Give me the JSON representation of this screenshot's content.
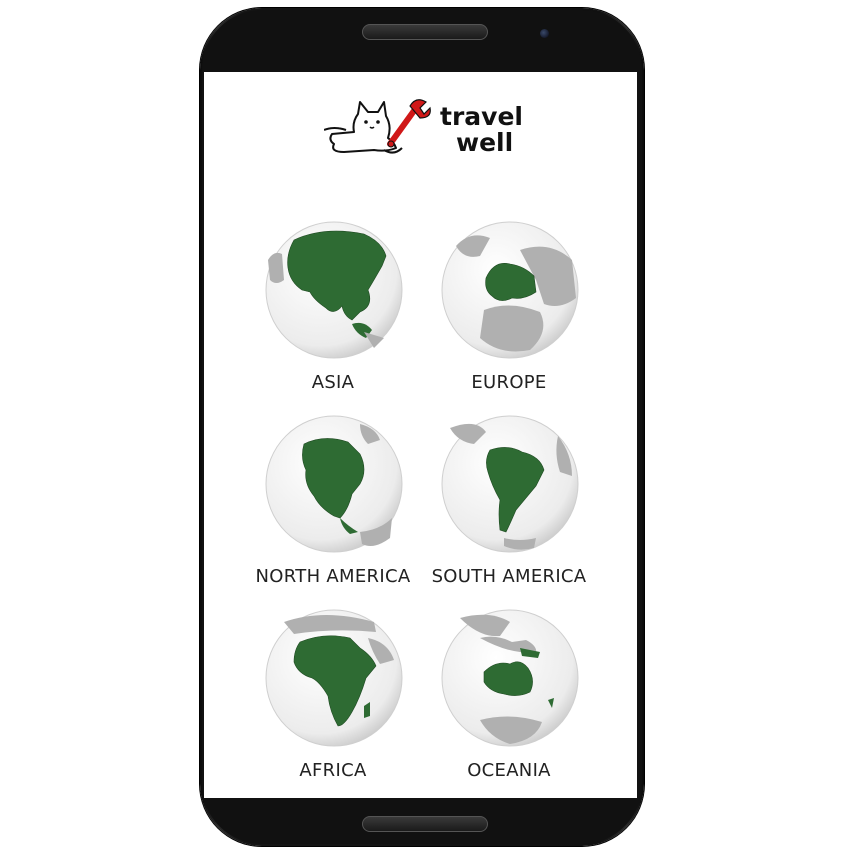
{
  "app": {
    "logo_line1": "travel",
    "logo_line2": "well"
  },
  "continents": [
    {
      "label": "ASIA",
      "icon": "asia-globe-icon"
    },
    {
      "label": "EUROPE",
      "icon": "europe-globe-icon"
    },
    {
      "label": "NORTH AMERICA",
      "icon": "north-america-globe-icon"
    },
    {
      "label": "SOUTH AMERICA",
      "icon": "south-america-globe-icon"
    },
    {
      "label": "AFRICA",
      "icon": "africa-globe-icon"
    },
    {
      "label": "OCEANIA",
      "icon": "oceania-globe-icon"
    }
  ],
  "colors": {
    "highlight": "#2e6b33",
    "land_gray": "#b0b0b0",
    "ocean": "#f2f2f2"
  }
}
